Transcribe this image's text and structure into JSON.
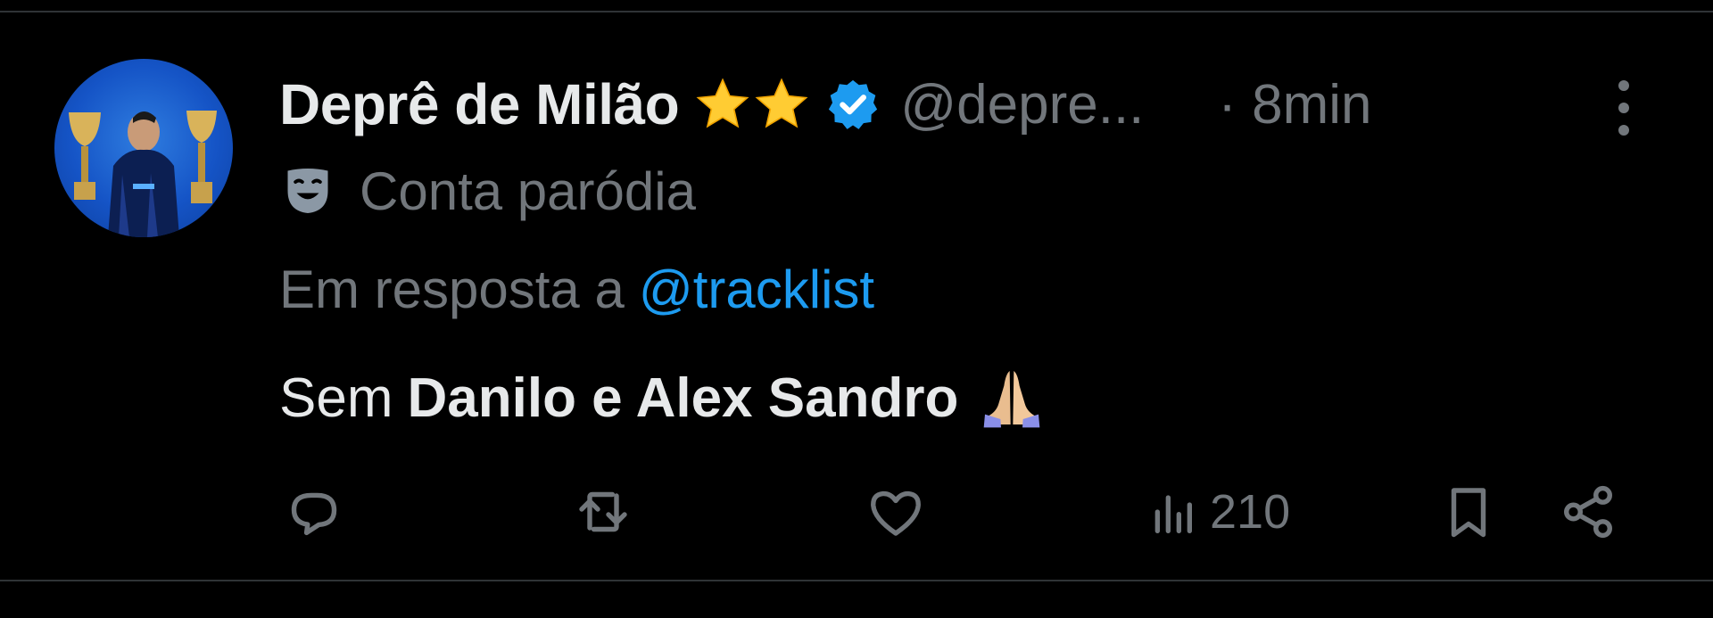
{
  "post": {
    "author": {
      "display_name": "Deprê de Milão",
      "badge_emoji": "⭐⭐",
      "handle": "@depre...",
      "verified": true,
      "avatar": "avatar-player-with-trophies"
    },
    "time_text": "· 8min",
    "parody_label": "Conta paródia",
    "reply_prefix": "Em resposta a",
    "reply_to": "@tracklist",
    "text_plain": "Sem",
    "text_bold": "Danilo e Alex Sandro",
    "text_emoji": "🙏",
    "metrics": {
      "views": "210"
    },
    "icons": {
      "more": "more-vertical-icon",
      "reply": "reply-icon",
      "repost": "repost-icon",
      "like": "heart-icon",
      "views": "views-chart-icon",
      "bookmark": "bookmark-icon",
      "share": "share-icon",
      "parody": "theater-mask-icon",
      "verified": "verified-badge-icon"
    }
  },
  "colors": {
    "background": "#000000",
    "text": "#e7e9ea",
    "muted": "#71767b",
    "link": "#1d9bf0",
    "verified": "#1d9bf0",
    "divider": "#2f3336",
    "star": "#ffcc33"
  }
}
